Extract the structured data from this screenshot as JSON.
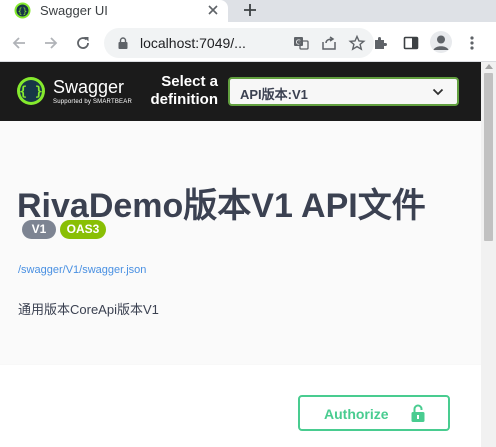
{
  "browser": {
    "tab": {
      "title": "Swagger UI",
      "favicon": "swagger-favicon-icon"
    },
    "url": "localhost:7049/...",
    "icons": {
      "back": "arrow-left-icon",
      "forward": "arrow-right-icon",
      "reload": "reload-icon",
      "lock": "lock-icon",
      "translate": "translate-icon",
      "share": "share-icon",
      "bookmark": "star-icon",
      "extensions": "puzzle-icon",
      "sidepanel": "side-panel-icon",
      "profile": "avatar-icon",
      "menu": "kebab-menu-icon"
    }
  },
  "topbar": {
    "brand": "Swagger",
    "brand_sub": "Supported by SMARTBEAR",
    "select_label_line1": "Select a",
    "select_label_line2": "definition",
    "selected_definition": "API版本:V1"
  },
  "info": {
    "title": "RivaDemo版本V1 API文件",
    "version_badge": "V1",
    "oas_badge": "OAS3",
    "spec_url": "/swagger/V1/swagger.json",
    "description": "通用版本CoreApi版本V1"
  },
  "auth": {
    "button_label": "Authorize"
  },
  "colors": {
    "topbar_bg": "#1b1b1b",
    "swagger_green": "#62a03f",
    "authorize_green": "#49cc90",
    "oas_badge": "#89bf04",
    "version_badge": "#7d8492",
    "title_text": "#3b4151",
    "link": "#4990e2"
  }
}
